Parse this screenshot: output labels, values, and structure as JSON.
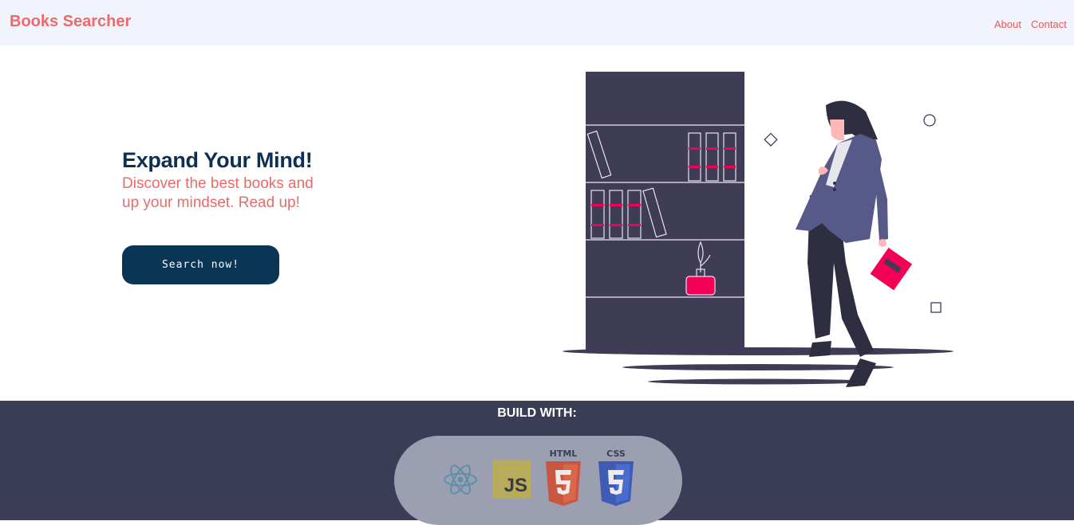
{
  "navbar": {
    "brand": "Books Searcher",
    "links": [
      "About",
      "Contact"
    ]
  },
  "hero": {
    "title": "Expand Your Mind!",
    "subtitle": "Discover the best books and up your mindset. Read up!",
    "cta_label": "Search now!"
  },
  "footer": {
    "title": "BUILD WITH:",
    "logos": [
      {
        "name": "react-icon"
      },
      {
        "name": "javascript-icon",
        "text": "JS"
      },
      {
        "name": "html5-icon",
        "text": "HTML"
      },
      {
        "name": "css3-icon",
        "text": "CSS"
      }
    ]
  },
  "colors": {
    "brand": "#ec6a6a",
    "navy": "#0a3554",
    "footer_bg": "#3b3d56",
    "accent_pink": "#f50057",
    "shelf": "#3f3d56"
  }
}
